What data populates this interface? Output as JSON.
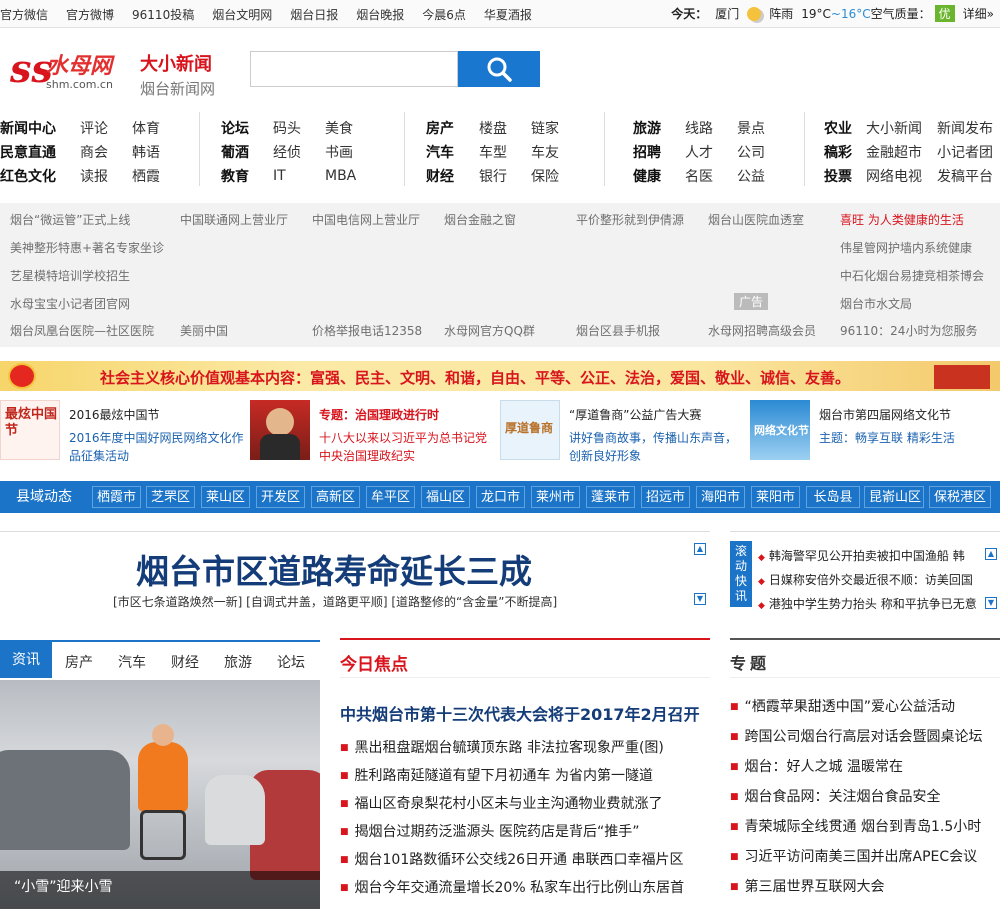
{
  "topbar": {
    "links": [
      "官方微信",
      "官方微博",
      "96110投稿",
      "烟台文明网",
      "烟台日报",
      "烟台晚报",
      "今晨6点",
      "华夏酒报"
    ],
    "weather": {
      "today_label": "今天：",
      "city": "厦门",
      "condition": "阵雨",
      "high": "19°C",
      "sep": "~",
      "low": "16°C",
      "aq_label": "空气质量：",
      "aq_value": "优",
      "detail": "详细»"
    }
  },
  "header": {
    "logo_text": "水母网",
    "logo_url": "shm.com.cn",
    "sub_title": "大小新闻",
    "sub_title2": "烟台新闻网",
    "search_placeholder": ""
  },
  "nav": {
    "col1": [
      [
        "新闻中心",
        "评论",
        "体育"
      ],
      [
        "民意直通",
        "商会",
        "韩语"
      ],
      [
        "红色文化",
        "读报",
        "栖霞"
      ]
    ],
    "col2": [
      [
        "论坛",
        "码头",
        "美食"
      ],
      [
        "葡酒",
        "经侦",
        "书画"
      ],
      [
        "教育",
        "IT",
        "MBA"
      ]
    ],
    "col3": [
      [
        "房产",
        "楼盘",
        "链家"
      ],
      [
        "汽车",
        "车型",
        "车友"
      ],
      [
        "财经",
        "银行",
        "保险"
      ]
    ],
    "col4": [
      [
        "旅游",
        "线路",
        "景点"
      ],
      [
        "招聘",
        "人才",
        "公司"
      ],
      [
        "健康",
        "名医",
        "公益"
      ]
    ],
    "col5": [
      [
        "农业",
        "大小新闻",
        "新闻发布"
      ],
      [
        "稿彩",
        "金融超市",
        "小记者团"
      ],
      [
        "投票",
        "网络电视",
        "发稿平台"
      ]
    ]
  },
  "ads": {
    "r1": [
      "烟台“微运管”正式上线",
      "中国联通网上营业厅",
      "中国电信网上营业厅",
      "烟台金融之窗",
      "平价整形就到伊倩源",
      "烟台山医院血透室",
      "喜旺 为人类健康的生活"
    ],
    "r2": [
      "美神整形特惠+著名专家坐诊",
      "伟星管网护墙内系统健康"
    ],
    "r3": [
      "艺星模特培训学校招生",
      "中石化烟台易捷竞相茶博会"
    ],
    "r4": [
      "水母宝宝小记者团官网",
      "广告",
      "烟台市水文局"
    ],
    "r5": [
      "烟台凤凰台医院—社区医院",
      "美丽中国",
      "价格举报电话12358",
      "水母网官方QQ群",
      "烟台区县手机报",
      "水母网招聘高级会员",
      "96110：24小时为您服务"
    ]
  },
  "banner": {
    "text": "社会主义核心价值观基本内容：富强、民主、文明、和谐，自由、平等、公正、法治，爱国、敬业、诚信、友善。"
  },
  "features": [
    {
      "thumb_text": "最炫中国节",
      "title": "2016最炫中国节",
      "desc1": "2016年度中国好网民网络文化作",
      "desc2": "品征集活动"
    },
    {
      "title": "专题：治国理政进行时",
      "desc1": "十八大以来以习近平为总书记党",
      "desc2": "中央治国理政纪实"
    },
    {
      "thumb_text": "厚道鲁商",
      "title": "“厚道鲁商”公益广告大赛",
      "desc1": "讲好鲁商故事，传播山东声音，",
      "desc2": "创新良好形象"
    },
    {
      "thumb_text": "网络文化节",
      "title": "烟台市第四届网络文化节",
      "desc1": "主题：畅享互联  精彩生活"
    }
  ],
  "county": {
    "label": "县域动态",
    "items": [
      "栖霞市",
      "芝罘区",
      "莱山区",
      "开发区",
      "高新区",
      "牟平区",
      "福山区",
      "龙口市",
      "莱州市",
      "蓬莱市",
      "招远市",
      "海阳市",
      "莱阳市",
      "长岛县",
      "昆嵛山区",
      "保税港区"
    ]
  },
  "headline": {
    "title": "烟台市区道路寿命延长三成",
    "sub": "[市区七条道路焕然一新] [自调式井盖，道路更平顺] [道路整修的“含金量”不断提高]"
  },
  "scroll": {
    "label": "滚动快讯",
    "items": [
      "韩海警罕见公开拍卖被扣中国渔船 韩",
      "日媒称安倍外交最近很不顺：访美回国",
      "港独中学生势力抬头 称和平抗争已无意"
    ]
  },
  "tabs": [
    "资讯",
    "房产",
    "汽车",
    "财经",
    "旅游",
    "论坛"
  ],
  "photo": {
    "caption": "“小雪”迎来小雪"
  },
  "focus": {
    "title": "今日焦点",
    "lead": "中共烟台市第十三次代表大会将于2017年2月召开",
    "items": [
      "黑出租盘踞烟台毓璜顶东路 非法拉客现象严重(图)",
      "胜利路南延隧道有望下月初通车 为省内第一隧道",
      "福山区奇泉梨花村小区未与业主沟通物业费就涨了",
      "揭烟台过期药泛滥源头 医院药店是背后“推手”",
      "烟台101路数循环公交线26日开通 串联西口幸福片区",
      "烟台今年交通流量增长20% 私家车出行比例山东居首"
    ]
  },
  "topics": {
    "title": "专题",
    "items": [
      "“栖霞苹果甜透中国”爱心公益活动",
      "跨国公司烟台行高层对话会暨圆桌论坛",
      "烟台：好人之城 温暖常在",
      "烟台食品网：关注烟台食品安全",
      "青荣城际全线贯通 烟台到青岛1.5小时",
      "习近平访问南美三国并出席APEC会议",
      "第三届世界互联网大会"
    ]
  },
  "colors": {
    "brand_blue": "#1b74c8",
    "brand_red": "#d8141d",
    "headline_navy": "#143c78"
  }
}
